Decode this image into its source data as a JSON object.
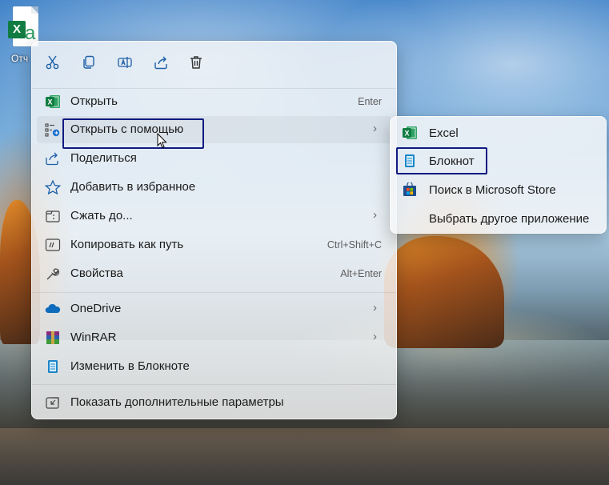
{
  "desktop": {
    "icon": {
      "name": "excel-file-icon",
      "caption": "Отч"
    }
  },
  "toolbar": {
    "buttons": [
      {
        "id": "cut",
        "icon": "scissors-icon"
      },
      {
        "id": "copy",
        "icon": "copy-icon"
      },
      {
        "id": "rename",
        "icon": "rename-icon"
      },
      {
        "id": "share",
        "icon": "share-icon"
      },
      {
        "id": "delete",
        "icon": "trash-icon"
      }
    ]
  },
  "menu": {
    "items": [
      {
        "label": "Открыть",
        "shortcut": "Enter",
        "icon": "excel-icon"
      },
      {
        "label": "Открыть с помощью",
        "icon": "open-with-icon",
        "has_submenu": true
      },
      {
        "label": "Поделиться",
        "icon": "share-icon"
      },
      {
        "label": "Добавить в избранное",
        "icon": "star-icon"
      },
      {
        "label": "Сжать до...",
        "icon": "compress-icon",
        "has_submenu": true
      },
      {
        "label": "Копировать как путь",
        "shortcut": "Ctrl+Shift+C",
        "icon": "path-icon"
      },
      {
        "label": "Свойства",
        "shortcut": "Alt+Enter",
        "icon": "wrench-icon"
      },
      {
        "label": "OneDrive",
        "icon": "onedrive-icon",
        "has_submenu": true
      },
      {
        "label": "WinRAR",
        "icon": "winrar-icon",
        "has_submenu": true
      },
      {
        "label": "Изменить в Блокноте",
        "icon": "notepad-icon"
      },
      {
        "label": "Показать дополнительные параметры",
        "icon": "more-options-icon"
      }
    ]
  },
  "submenu": {
    "items": [
      {
        "label": "Excel",
        "icon": "excel-icon"
      },
      {
        "label": "Блокнот",
        "icon": "notepad-icon"
      },
      {
        "label": "Поиск в Microsoft Store",
        "icon": "store-icon"
      },
      {
        "label": "Выбрать другое приложение",
        "icon": ""
      }
    ]
  },
  "colors": {
    "highlight_border": "#101a80",
    "excel_green": "#107c41",
    "accent_blue": "#0067c0"
  }
}
